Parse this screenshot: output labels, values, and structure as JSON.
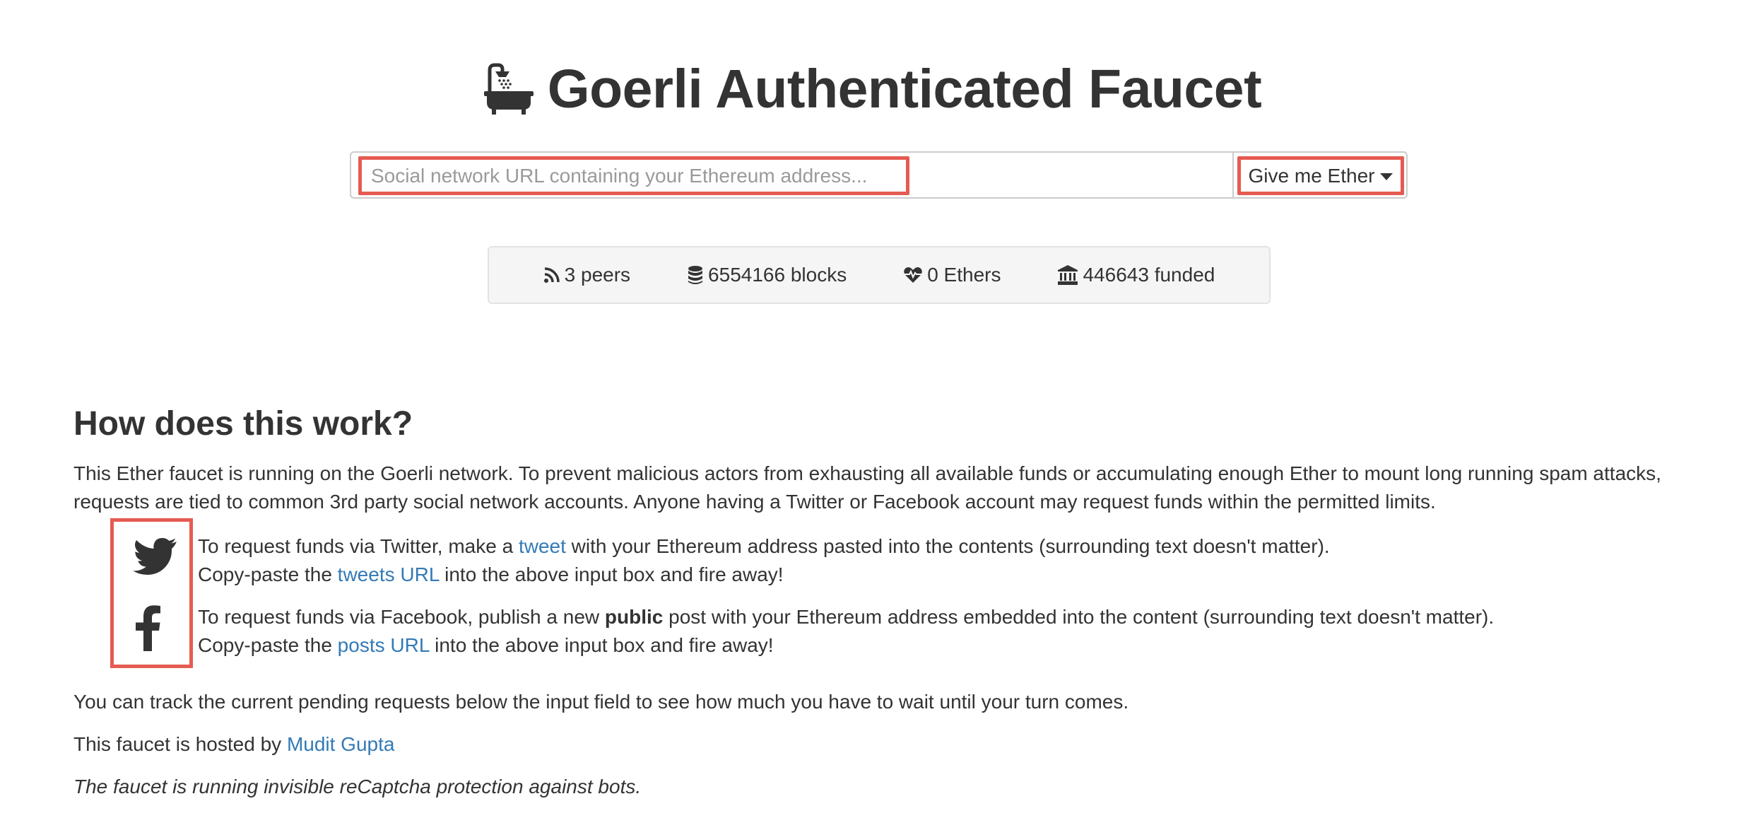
{
  "header": {
    "title": "Goerli Authenticated Faucet",
    "icon": "bathtub-shower-icon"
  },
  "request": {
    "placeholder": "Social network URL containing your Ethereum address...",
    "value": "",
    "button_label": "Give me Ether"
  },
  "stats": {
    "peers": "3 peers",
    "blocks": "6554166 blocks",
    "ethers": "0 Ethers",
    "funded": "446643 funded"
  },
  "how": {
    "heading": "How does this work?",
    "intro_line1": "This Ether faucet is running on the Goerli network. To prevent malicious actors from exhausting all available funds or accumulating enough Ether to mount long running spam attacks,",
    "intro_line2": "requests are tied to common 3rd party social network accounts. Anyone having a Twitter or Facebook account may request funds within the permitted limits.",
    "twitter": {
      "line1_before": "To request funds via Twitter, make a ",
      "line1_link": "tweet",
      "line1_after": " with your Ethereum address pasted into the contents (surrounding text doesn't matter).",
      "line2_before": "Copy-paste the ",
      "line2_link": "tweets URL",
      "line2_after": " into the above input box and fire away!"
    },
    "facebook": {
      "line1_before": "To request funds via Facebook, publish a new ",
      "line1_bold": "public",
      "line1_after": " post with your Ethereum address embedded into the content (surrounding text doesn't matter).",
      "line2_before": "Copy-paste the ",
      "line2_link": "posts URL",
      "line2_after": " into the above input box and fire away!"
    },
    "track": "You can track the current pending requests below the input field to see how much you have to wait until your turn comes.",
    "hosted_before": "This faucet is hosted by ",
    "hosted_link": "Mudit Gupta",
    "captcha_note": "The faucet is running invisible reCaptcha protection against bots."
  },
  "colors": {
    "highlight": "#e55b52",
    "link": "#337ab7",
    "text": "#333333"
  }
}
